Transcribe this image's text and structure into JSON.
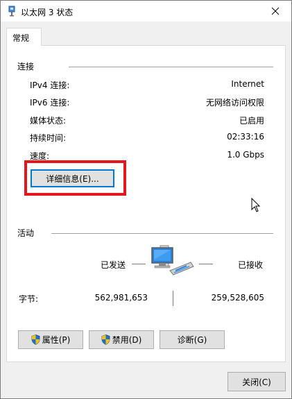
{
  "window": {
    "title": "以太网 3 状态",
    "close_symbol": "✕"
  },
  "tabs": [
    {
      "label": "常规"
    }
  ],
  "connection": {
    "section_label": "连接",
    "rows": [
      {
        "label": "IPv4 连接:",
        "value": "Internet"
      },
      {
        "label": "IPv6 连接:",
        "value": "无网络访问权限"
      },
      {
        "label": "媒体状态:",
        "value": "已启用"
      },
      {
        "label": "持续时间:",
        "value": "02:33:16"
      },
      {
        "label": "速度:",
        "value": "1.0 Gbps"
      }
    ],
    "details_button": "详细信息(E)..."
  },
  "activity": {
    "section_label": "活动",
    "sent_label": "已发送",
    "received_label": "已接收",
    "bytes_label": "字节:",
    "bytes_sent": "562,981,653",
    "bytes_received": "259,528,605"
  },
  "buttons": {
    "properties": "属性(P)",
    "disable": "禁用(D)",
    "diagnose": "诊断(G)",
    "close": "关闭(C)"
  },
  "icons": {
    "window": "network-adapter-icon",
    "network": "network-computer-icon",
    "shield": "uac-shield-icon",
    "cursor": "mouse-cursor-icon"
  },
  "colors": {
    "highlight": "#e8141b",
    "focus": "#0078d7",
    "monitor": "#2d7fd3"
  }
}
